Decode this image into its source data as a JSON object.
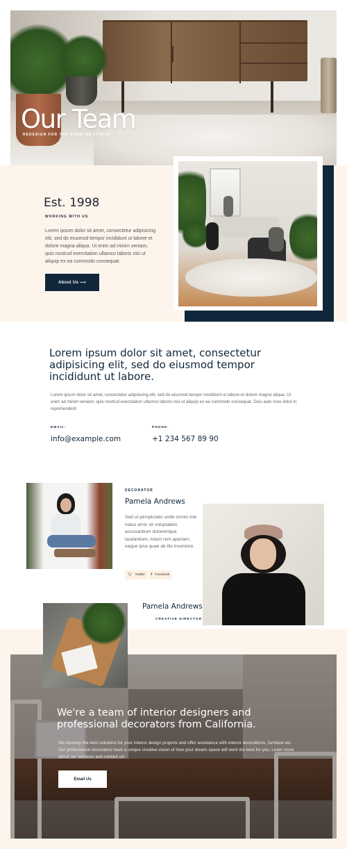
{
  "hero": {
    "title": "Our Team",
    "subtitle": "REDESIGN FOR THE HOME WE LIVE IN"
  },
  "about": {
    "heading": "Est. 1998",
    "eyebrow": "WORKING WITH US",
    "body": "Lorem ipsum dolor sit amet, consectetur adipisicing elit, sed do eiusmod tempor incididunt ut labore et dolore magna aliqua. Ut enim ad minim veniam, quis nostrud exercitation ullamco laboris nisi ut aliquip ex ea commodo consequat.",
    "button": "About Us ⟶"
  },
  "intro": {
    "heading": "Lorem ipsum dolor sit amet, consectetur adipisicing elit, sed do eiusmod tempor incididunt ut labore.",
    "body": "Lorem ipsum dolor sit amet, consectetur adipisicing elit, sed do eiusmod tempor incididunt ut labore et dolore magna aliqua. Ut enim ad minim veniam, quis nostrud exercitation ullamco laboris nisi ut aliquip ex ea commodo consequat. Duis aute irure dolor in reprehenderit.",
    "email_label": "EMAIL:",
    "email": "info@example.com",
    "phone_label": "PHONE:",
    "phone": "+1 234 567 89 90"
  },
  "team": {
    "member1": {
      "role": "DECORATOR",
      "name": "Pamela Andrews",
      "bio": "Sed ut perspiciatis unde omnis iste natus error sit voluptatem accusantium doloremque laudantium, totam rem aperiam, eaque ipsa quae ab illo inventore.",
      "twitter": "Twitter",
      "facebook": "Facebook"
    },
    "member2": {
      "name": "Pamela Andrews",
      "role": "CREATIVE DIRECTOR"
    }
  },
  "cta": {
    "heading": "We're a team of interior designers and professional decorators from California.",
    "body": "We develop the best solutions for your interior design projects and offer assistance with interior decorations, furniture etc. Our professional decorators have a unique creative vision of how your dream space will work the best for you. Learn more about our services and contact us!",
    "button": "Email Us"
  },
  "colors": {
    "navy": "#10263a",
    "cream": "#fdf5ec"
  }
}
